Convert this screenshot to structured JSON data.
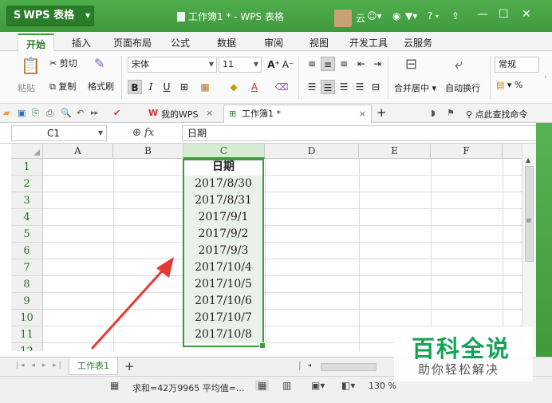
{
  "colors": {
    "title_bar": "#3f9a3c",
    "accent": "#2c7d2a",
    "selection": "#3f9a3c",
    "arrow": "#e53935",
    "watermark": "#14a356"
  },
  "titlebar": {
    "app_name": "WPS 表格",
    "app_logo": "S",
    "doc_title": "工作簿1 * - WPS 表格",
    "user": "云",
    "icons": [
      "avatar-icon",
      "user-circle-icon",
      "shirt-icon",
      "help-icon",
      "minimize-icon",
      "restore-icon",
      "close-icon"
    ],
    "help": "?",
    "minimize": "—",
    "restore": "☐",
    "close": "✕"
  },
  "ribbon_tabs": [
    "开始",
    "插入",
    "页面布局",
    "公式",
    "数据",
    "审阅",
    "视图",
    "开发工具",
    "云服务"
  ],
  "ribbon": {
    "paste": "粘贴",
    "cut": "剪切",
    "copy": "复制",
    "format_painter": "格式刷",
    "font_name": "宋体",
    "font_size": "11",
    "bold": "B",
    "italic": "I",
    "underline": "U",
    "font_grow": "A⁺",
    "font_shrink": "A⁻",
    "merge_center": "合并居中",
    "wrap_text": "自动换行",
    "number_format": "常规",
    "percent": "%"
  },
  "quickbar": {
    "my_wps": "我的WPS",
    "doc_tab": "工作簿1 *",
    "search": "点此查找命令",
    "new_tab": "+",
    "close_tab": "×"
  },
  "formula_bar": {
    "name_box": "C1",
    "fx": "fx",
    "value": "日期"
  },
  "sheet": {
    "columns": [
      "A",
      "B",
      "C",
      "D",
      "E",
      "F"
    ],
    "rows": [
      "1",
      "2",
      "3",
      "4",
      "5",
      "6",
      "7",
      "8",
      "9",
      "10",
      "11",
      "12"
    ],
    "column_c": [
      "日期",
      "2017/8/30",
      "2017/8/31",
      "2017/9/1",
      "2017/9/2",
      "2017/9/3",
      "2017/10/4",
      "2017/10/5",
      "2017/10/6",
      "2017/10/7",
      "2017/10/8"
    ]
  },
  "sheet_tabs": {
    "active": "工作表1",
    "add": "+"
  },
  "statusbar": {
    "sum": "求和=42万9965",
    "average": "平均值=...",
    "zoom": "130 %"
  },
  "watermark": {
    "title": "百科全说",
    "subtitle": "助你轻松解决"
  }
}
